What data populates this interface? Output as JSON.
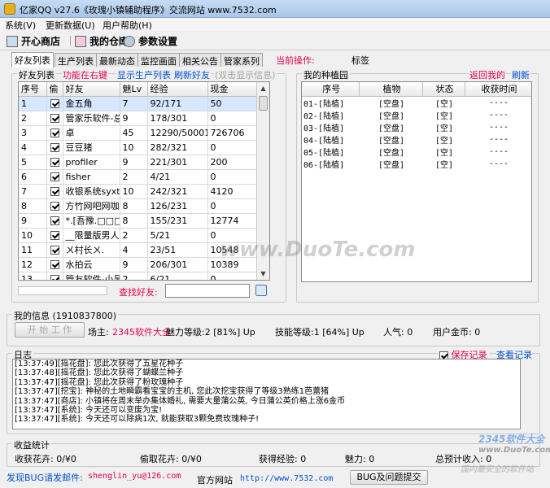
{
  "window": {
    "title": "亿家QQ v27.6《玫瑰小镇辅助程序》交流网站 www.7532.com"
  },
  "menu": [
    "系统(V)",
    "更新数据(U)",
    "用户帮助(H)"
  ],
  "toolbar": {
    "shop": "开心商店",
    "warehouse": "我的仓库",
    "settings": "参数设置"
  },
  "tabs": [
    "好友列表",
    "生产列表",
    "最新动态",
    "监控画面",
    "相关公告",
    "管家系列"
  ],
  "current_op": {
    "label": "当前操作:",
    "tag": "标签"
  },
  "friends": {
    "group_title": "好友列表",
    "link_func": "功能在右键",
    "link_prod": "显示生产列表",
    "link_refresh": "刷新好友",
    "hint": "(双击显示信息)",
    "columns": [
      "序号",
      "偷",
      "好友",
      "魅Lv",
      "经验",
      "现金"
    ],
    "rows": [
      [
        "1",
        "",
        "金五角",
        "7",
        "92/171",
        "50"
      ],
      [
        "2",
        "",
        "管家乐软件-总",
        "9",
        "178/301",
        "0"
      ],
      [
        "3",
        "",
        "卓",
        "45",
        "12290/50001",
        "726706"
      ],
      [
        "4",
        "",
        "豆豆猪",
        "10",
        "282/321",
        "0"
      ],
      [
        "5",
        "",
        "profiler",
        "9",
        "221/301",
        "200"
      ],
      [
        "6",
        "",
        "fisher",
        "2",
        "4/21",
        "0"
      ],
      [
        "7",
        "",
        "收银系统syxt.",
        "10",
        "242/321",
        "4120"
      ],
      [
        "8",
        "",
        "方竹网吧网咖",
        "8",
        "126/231",
        "0"
      ],
      [
        "9",
        "",
        "*.[吾豫.□□□□",
        "8",
        "155/231",
        "12774"
      ],
      [
        "10",
        "",
        "__限量版男人",
        "2",
        "5/21",
        "0"
      ],
      [
        "11",
        "",
        "ㄨ村长ㄨ.",
        "4",
        "23/51",
        "10548"
      ],
      [
        "12",
        "",
        "水拍云",
        "9",
        "206/301",
        "10389"
      ],
      [
        "13",
        "",
        "管友软件-小吴",
        "2",
        "6/21",
        "0"
      ]
    ]
  },
  "search": {
    "label": "查找好友:",
    "value": ""
  },
  "garden": {
    "group_title": "我的种植园",
    "link_back": "返回我的",
    "link_refresh": "刷新",
    "columns": [
      "序号",
      "植物",
      "状态",
      "收获时间"
    ],
    "rows": [
      [
        "01-[陆植]",
        "[空盘]",
        "[空]",
        "----"
      ],
      [
        "02-[陆植]",
        "[空盘]",
        "[空]",
        "----"
      ],
      [
        "03-[陆植]",
        "[空盘]",
        "[空]",
        "----"
      ],
      [
        "04-[陆植]",
        "[空盘]",
        "[空]",
        "----"
      ],
      [
        "05-[陆植]",
        "[空盘]",
        "[空]",
        "----"
      ],
      [
        "06-[陆植]",
        "[空盘]",
        "[空]",
        "----"
      ]
    ]
  },
  "myinfo": {
    "title": "我的信息 (1910837800)",
    "start_button": "开 始 工 作",
    "owner_label": "场主:",
    "owner_value": "2345软件大全",
    "charm": "魅力等级:2 [81%] Up",
    "skill": "技能等级:1 [64%] Up",
    "popularity": "人气: 0",
    "gold": "用户金币: 0"
  },
  "log": {
    "title": "日志",
    "save_label": "保存记录",
    "save_checked": true,
    "view_label": "查看记录",
    "lines": [
      "[13:37:49][摇花盘]: 您此次获得了五星花种子",
      "[13:37:48][摇花盘]: 您此次获得了蝴蝶兰种子",
      "[13:37:47][摇花盘]: 您此次获得了粉玫瑰种子",
      "[13:37:47][挖宝]: 神秘的土地瞬霸看宝宝的主机, 您此次挖宝获得了等级3熟练1芭蕾猪",
      "[13:37:47][商店]: 小镇将在周末举办集体婚礼, 需要大量蒲公英, 今日蒲公英价格上涨6金币",
      "[13:37:47][系统]: 今天还可以变废为宝!",
      "[13:37:47][系统]: 今天还可以除病1次, 就能获取3颗免费玫瑰种子!"
    ]
  },
  "income": {
    "title": "收益统计",
    "flowers": "收获花卉: 0/¥0",
    "stolen": "偷取花卉: 0/¥0",
    "exp": "获得经验: 0",
    "charm": "魅力: 0",
    "total": "总预计收入: 0"
  },
  "footer": {
    "bug_label": "发现BUG请发邮件:",
    "email": "shenglin_yu@126.com",
    "site_label": "官方网站",
    "site_url": "http://www.7532.com",
    "submit_button": "BUG及问题提交"
  },
  "watermarks": {
    "center": "www.DuoTe.com",
    "corner1": "2345软件大全",
    "corner2": "www.DuoTe.com",
    "corner3": "国内最安全的软件站"
  }
}
